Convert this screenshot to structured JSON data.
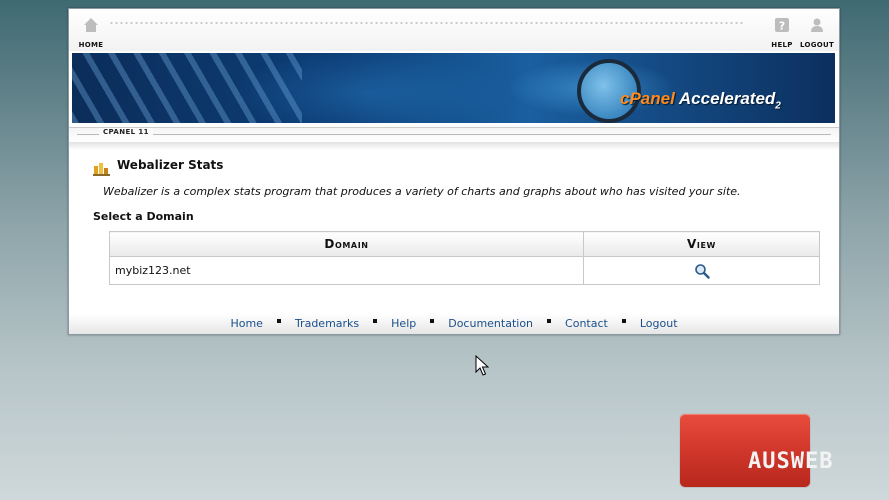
{
  "topbar": {
    "home_label": "HOME",
    "help_label": "HELP",
    "logout_label": "LOGOUT"
  },
  "banner": {
    "logo_brand": "cPanel",
    "logo_suffix": "Accelerated",
    "logo_sub": "2"
  },
  "breadcrumb": {
    "label": "CPANEL 11"
  },
  "page": {
    "title": "Webalizer Stats",
    "description": "Webalizer is a complex stats program that produces a variety of charts and graphs about who has visited your site.",
    "section_label": "Select a Domain"
  },
  "table": {
    "headers": [
      "Domain",
      "View"
    ],
    "rows": [
      {
        "domain": "mybiz123.net",
        "view_icon": "magnifier-icon"
      }
    ]
  },
  "footer": {
    "links": [
      "Home",
      "Trademarks",
      "Help",
      "Documentation",
      "Contact",
      "Logout"
    ]
  },
  "watermark": {
    "text": "AUSWEB"
  },
  "colors": {
    "link": "#1a4f8a",
    "brand_red": "#d3392c",
    "banner_blue": "#0d3f78"
  }
}
